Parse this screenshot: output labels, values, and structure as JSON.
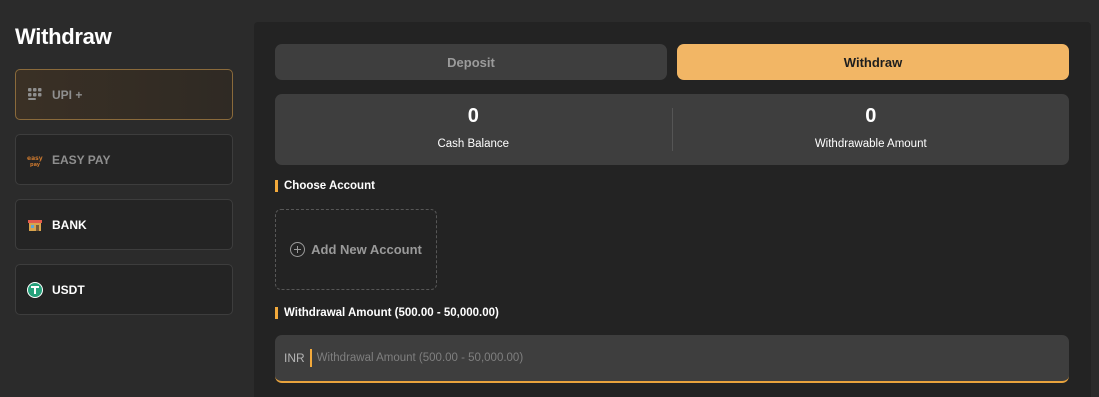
{
  "page": {
    "title": "Withdraw"
  },
  "methods": [
    {
      "label": "UPI +",
      "icon": "upi-icon",
      "state": "active"
    },
    {
      "label": "EASY PAY",
      "icon": "easypay-icon",
      "state": "muted"
    },
    {
      "label": "BANK",
      "icon": "bank-icon",
      "state": "normal"
    },
    {
      "label": "USDT",
      "icon": "tether-icon",
      "state": "normal"
    }
  ],
  "tabs": {
    "deposit": "Deposit",
    "withdraw": "Withdraw",
    "active": "withdraw"
  },
  "balances": {
    "cash_value": "0",
    "cash_label": "Cash Balance",
    "withdrawable_value": "0",
    "withdrawable_label": "Withdrawable Amount"
  },
  "account": {
    "section_label": "Choose Account",
    "add_label": "Add New Account"
  },
  "amount": {
    "section_label": "Withdrawal Amount (500.00 - 50,000.00)",
    "currency": "INR",
    "value": "",
    "placeholder": "Withdrawal Amount (500.00 - 50,000.00)"
  },
  "colors": {
    "accent": "#f2b665",
    "accent_line": "#f2a93b",
    "background": "#2b2b2b",
    "panel": "#232323",
    "card": "#3e3e3e"
  }
}
